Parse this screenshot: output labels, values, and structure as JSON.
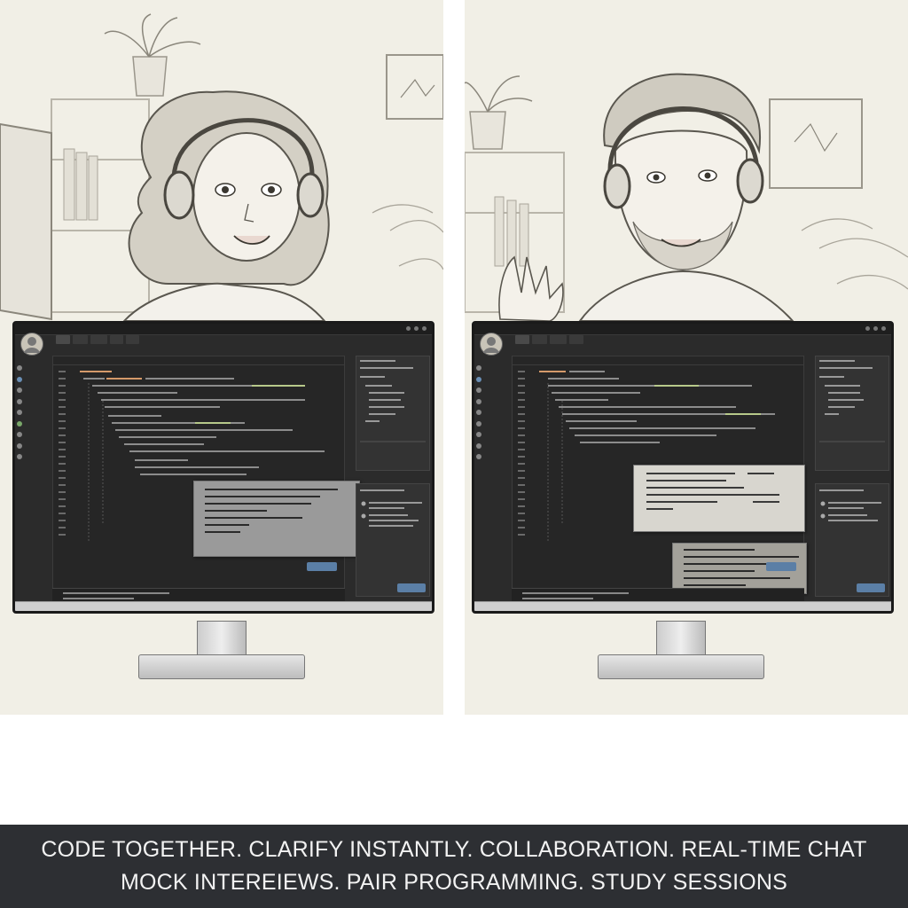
{
  "caption": {
    "line1": "CODE TOGETHER. CLARIFY INSTANTLY. COLLABORATION. REAL-TIME CHAT",
    "line2": "MOCK INTEREIEWS. PAIR PROGRAMMING. STUDY SESSIONS"
  },
  "colors": {
    "caption_bg": "#2d2f33",
    "caption_text": "#f2f2f2",
    "sketch_bg": "#f1efe6",
    "ide_bg": "#2b2b2b",
    "accent_button": "#5b7fa6"
  },
  "icons": [
    "avatar-icon",
    "window-dots-icon",
    "send-icon"
  ]
}
